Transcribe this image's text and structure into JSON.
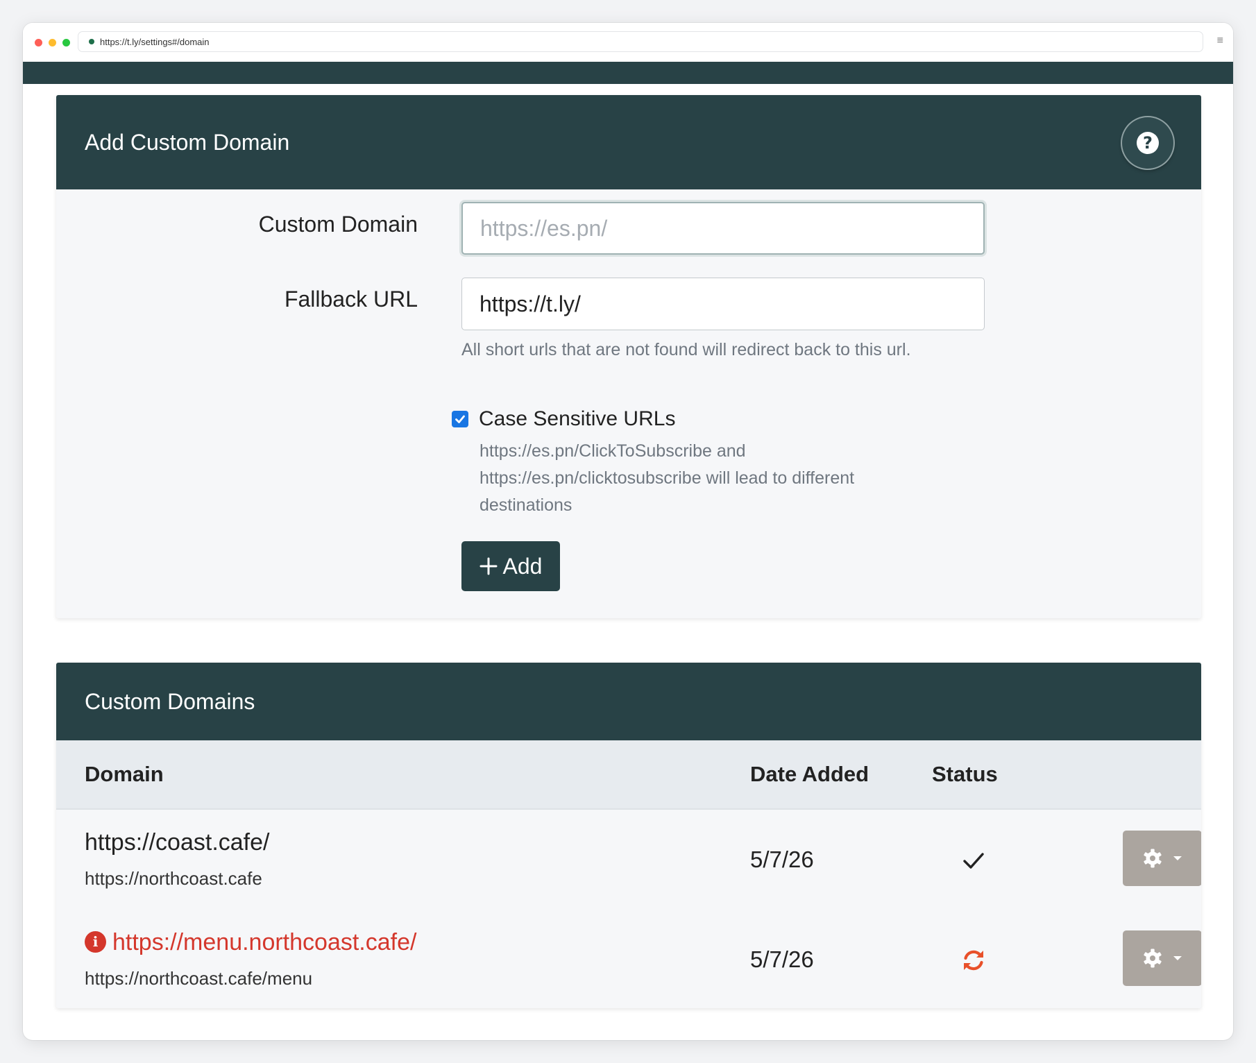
{
  "browser": {
    "url": "https://t.ly/settings#/domain"
  },
  "add_form": {
    "title": "Add Custom Domain",
    "custom_domain_label": "Custom Domain",
    "custom_domain_placeholder": "https://es.pn/",
    "custom_domain_value": "",
    "fallback_label": "Fallback URL",
    "fallback_value": "https://t.ly/",
    "fallback_help": "All short urls that are not found will redirect back to this url.",
    "case_sensitive_label": "Case Sensitive URLs",
    "case_sensitive_checked": true,
    "case_sensitive_help": "https://es.pn/ClickToSubscribe and https://es.pn/clicktosubscribe will lead to different destinations",
    "add_button_label": "Add"
  },
  "domains": {
    "title": "Custom Domains",
    "columns": [
      "Domain",
      "Date Added",
      "Status"
    ],
    "rows": [
      {
        "domain": "https://coast.cafe/",
        "fallback": "https://northcoast.cafe",
        "date_added": "5/7/26",
        "status_icon": "check-icon",
        "has_warning": false
      },
      {
        "domain": "https://menu.northcoast.cafe/",
        "fallback": "https://northcoast.cafe/menu",
        "date_added": "5/7/26",
        "status_icon": "sync-icon",
        "has_warning": true
      }
    ]
  },
  "colors": {
    "header_bg": "#284246",
    "error_red": "#d4372c",
    "sync_orange": "#e8502a",
    "checkbox_blue": "#1976e3",
    "action_button_bg": "#aba59f"
  }
}
